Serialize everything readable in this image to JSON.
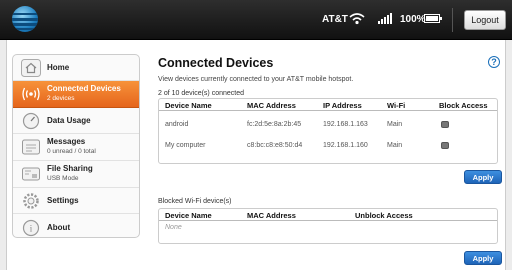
{
  "topbar": {
    "carrier": "AT&T",
    "battery": "100%",
    "battery_level": 1.0,
    "logout": "Logout"
  },
  "sidebar": {
    "items": [
      {
        "title": "Home",
        "sub": "",
        "icon": "home-icon"
      },
      {
        "title": "Connected Devices",
        "sub": "2 devices",
        "icon": "wifi-broadcast-icon",
        "active": true
      },
      {
        "title": "Data Usage",
        "sub": "",
        "icon": "gauge-icon"
      },
      {
        "title": "Messages",
        "sub": "0 unread / 0 total",
        "icon": "envelope-icon"
      },
      {
        "title": "File Sharing",
        "sub": "USB Mode",
        "icon": "sd-card-icon"
      },
      {
        "title": "Settings",
        "sub": "",
        "icon": "gear-icon"
      },
      {
        "title": "About",
        "sub": "",
        "icon": "info-icon"
      }
    ]
  },
  "main": {
    "title": "Connected Devices",
    "description": "View devices currently connected to your AT&T mobile hotspot.",
    "count": "2 of 10 device(s) connected",
    "connected_table": {
      "headers": [
        "Device Name",
        "MAC Address",
        "IP Address",
        "Wi-Fi",
        "Block Access"
      ],
      "rows": [
        {
          "name": "android",
          "mac": "fc:2d:5e:8a:2b:45",
          "ip": "192.168.1.163",
          "wifi": "Main"
        },
        {
          "name": "My computer",
          "mac": "c8:bc:c8:e8:50:d4",
          "ip": "192.168.1.160",
          "wifi": "Main"
        }
      ]
    },
    "apply": "Apply",
    "blocked_label": "Blocked Wi-Fi device(s)",
    "blocked_table": {
      "headers": [
        "Device Name",
        "MAC Address",
        "Unblock Access"
      ],
      "empty": "None"
    }
  },
  "colors": {
    "accent_orange": "#f07d2a",
    "button_blue": "#2a74c9",
    "help_blue": "#1a6fb9"
  }
}
